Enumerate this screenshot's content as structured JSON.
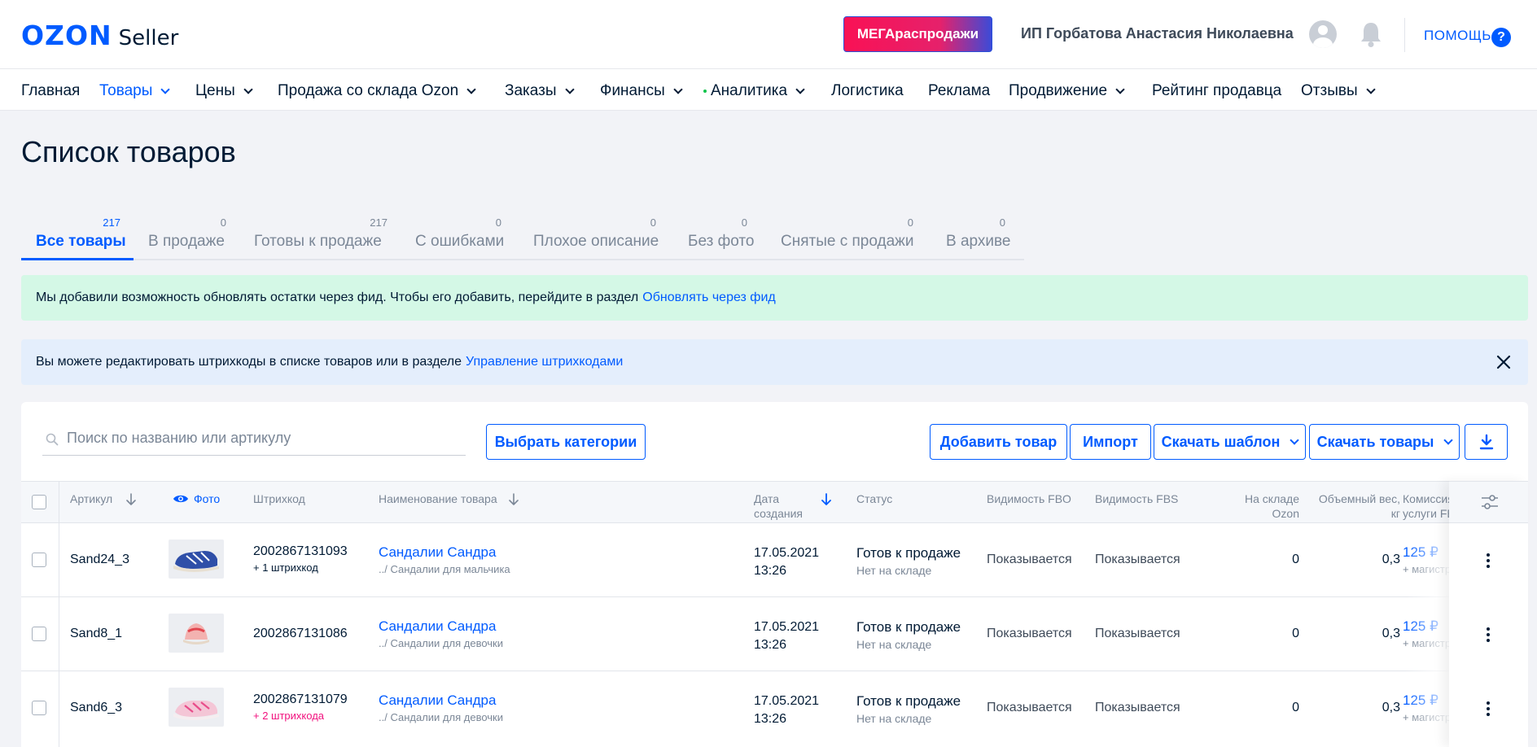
{
  "header": {
    "logo_brand": "OZON",
    "logo_suffix": "Seller",
    "promo_label": "МЕГАраспродажи",
    "user_name": "ИП Горбатова Анастасия Николаевна",
    "help_label": "ПОМОЩЬ",
    "help_icon_glyph": "?"
  },
  "nav": [
    {
      "label": "Главная"
    },
    {
      "label": "Товары"
    },
    {
      "label": "Цены"
    },
    {
      "label": "Продажа со склада Ozon"
    },
    {
      "label": "Заказы"
    },
    {
      "label": "Финансы"
    },
    {
      "label": "Аналитика"
    },
    {
      "label": "Логистика"
    },
    {
      "label": "Реклама"
    },
    {
      "label": "Продвижение"
    },
    {
      "label": "Рейтинг продавца"
    },
    {
      "label": "Отзывы"
    }
  ],
  "page_title": "Список товаров",
  "tabs": [
    {
      "label": "Все товары",
      "count": "217"
    },
    {
      "label": "В продаже",
      "count": "0"
    },
    {
      "label": "Готовы к продаже",
      "count": "217"
    },
    {
      "label": "С ошибками",
      "count": "0"
    },
    {
      "label": "Плохое описание",
      "count": "0"
    },
    {
      "label": "Без фото",
      "count": "0"
    },
    {
      "label": "Снятые с продажи",
      "count": "0"
    },
    {
      "label": "В архиве",
      "count": "0"
    }
  ],
  "banners": {
    "feed": {
      "text": "Мы добавили возможность обновлять остатки через фид. Чтобы его добавить, перейдите в раздел",
      "link": "Обновлять через фид"
    },
    "barcode": {
      "text": "Вы можете редактировать штрихкоды в списке товаров или в разделе",
      "link": "Управление штрихкодами"
    }
  },
  "toolbar": {
    "search_placeholder": "Поиск по названию или артикулу",
    "choose_categories": "Выбрать категории",
    "add_product": "Добавить товар",
    "import": "Импорт",
    "download_template": "Скачать шаблон",
    "download_products": "Скачать товары"
  },
  "table": {
    "headers": {
      "sku": "Артикул",
      "photo": "Фото",
      "barcode": "Штрихкод",
      "name": "Наименование товара",
      "created_1": "Дата",
      "created_2": "создания",
      "status": "Статус",
      "fbo": "Видимость FBO",
      "fbs": "Видимость FBS",
      "stock_1": "На складе",
      "stock_2": "Ozon",
      "weight_1": "Объемный вес,",
      "weight_2": "кг",
      "commission_1": "Комиссия",
      "commission_2": "услуги FBO"
    },
    "rows": [
      {
        "sku": "Sand24_3",
        "barcode": "2002867131093",
        "barcode_extra": "+ 1 штрихкод",
        "name": "Сандалии Сандра",
        "category": "../ Сандалии для мальчика",
        "date": "17.05.2021",
        "time": "13:26",
        "status": "Готов к продаже",
        "status_sub": "Нет на складе",
        "fbo": "Показывается",
        "fbs": "Показывается",
        "stock": "0",
        "weight": "0,3",
        "commission": "125 ₽",
        "commission_sub": "+ магистраль"
      },
      {
        "sku": "Sand8_1",
        "barcode": "2002867131086",
        "barcode_extra": "",
        "name": "Сандалии Сандра",
        "category": "../ Сандалии для девочки",
        "date": "17.05.2021",
        "time": "13:26",
        "status": "Готов к продаже",
        "status_sub": "Нет на складе",
        "fbo": "Показывается",
        "fbs": "Показывается",
        "stock": "0",
        "weight": "0,3",
        "commission": "125 ₽",
        "commission_sub": "+ магистраль"
      },
      {
        "sku": "Sand6_3",
        "barcode": "2002867131079",
        "barcode_extra": "+ 2 штрихкода",
        "name": "Сандалии Сандра",
        "category": "../ Сандалии для девочки",
        "date": "17.05.2021",
        "time": "13:26",
        "status": "Готов к продаже",
        "status_sub": "Нет на складе",
        "fbo": "Показывается",
        "fbs": "Показывается",
        "stock": "0",
        "weight": "0,3",
        "commission": "125 ₽",
        "commission_sub": "+ магистраль"
      }
    ]
  },
  "colors": {
    "brand_blue": "#005bff",
    "green_banner": "#d4f8e6",
    "blue_banner": "#e4eefc",
    "error_pink": "#f1117e"
  }
}
